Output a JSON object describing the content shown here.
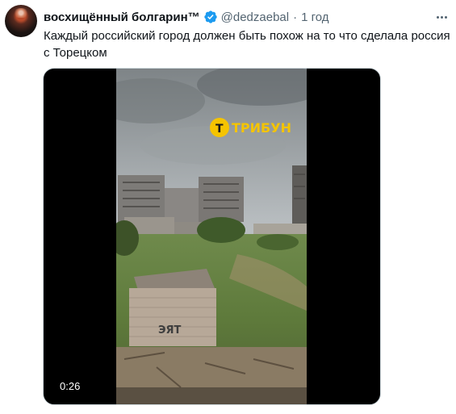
{
  "tweet": {
    "author_name": "восхищённый болгарин™",
    "handle": "@dedzaebal",
    "separator": "·",
    "time": "1 год",
    "text": "Каждый российский город должен быть похож на то что сделала россия с Торецком",
    "verified_color": "#1d9bf0"
  },
  "media": {
    "duration": "0:26",
    "watermark_letter": "Т",
    "watermark_text": "ТРИБУН",
    "watermark_color": "#f5c400",
    "graffiti": "ЭЯТ"
  },
  "icons": {
    "verified": "verified-badge-icon",
    "more": "more-options-icon"
  }
}
